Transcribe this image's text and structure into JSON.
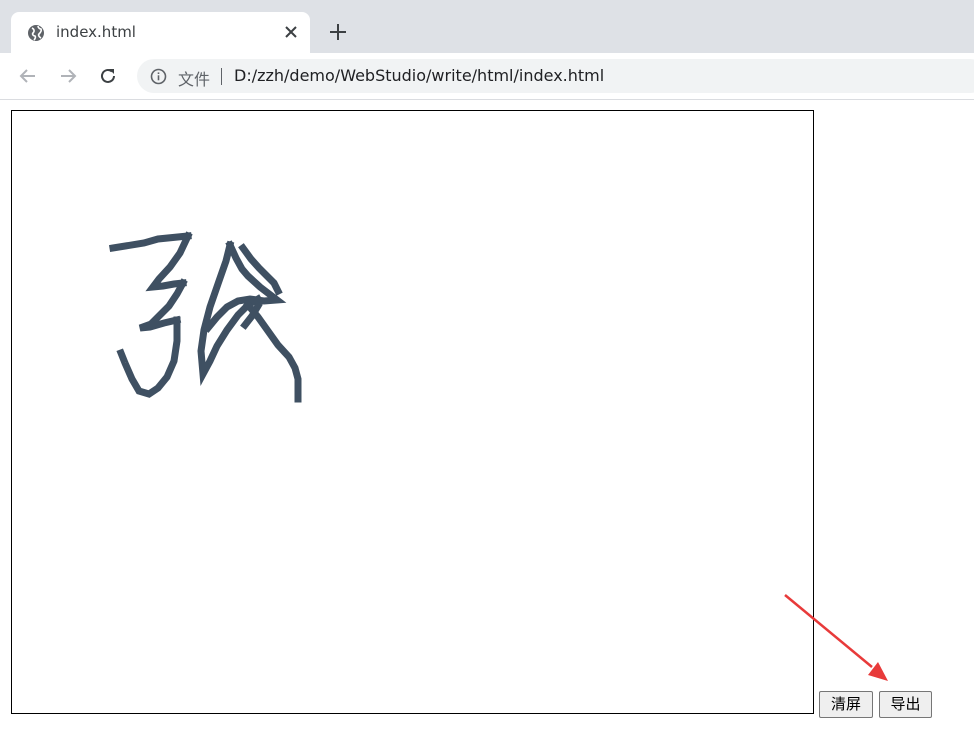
{
  "browser": {
    "tab": {
      "title": "index.html"
    },
    "address": {
      "scheme_label": "文件",
      "url": "D:/zzh/demo/WebStudio/write/html/index.html"
    }
  },
  "page": {
    "buttons": {
      "clear_label": "清屏",
      "export_label": "导出"
    },
    "stroke_color": "#3f5062",
    "annotation_color": "#e83a3a"
  }
}
